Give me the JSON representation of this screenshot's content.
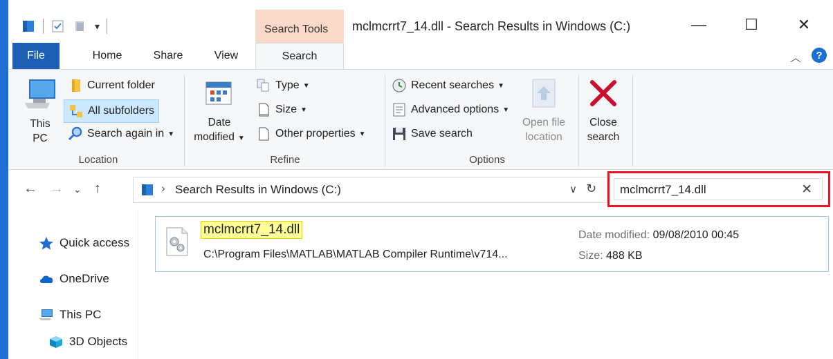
{
  "window": {
    "title": "mclmcrrt7_14.dll - Search Results in Windows (C:)",
    "context_tab_group": "Search Tools",
    "minimize": "—",
    "maximize": "☐",
    "close": "✕"
  },
  "tabs": [
    {
      "label": "File"
    },
    {
      "label": "Home"
    },
    {
      "label": "Share"
    },
    {
      "label": "View"
    },
    {
      "label": "Search"
    }
  ],
  "ribbon": {
    "location": {
      "label": "Location",
      "this_pc_line1": "This",
      "this_pc_line2": "PC",
      "current_folder": "Current folder",
      "all_subfolders": "All subfolders",
      "search_again_in": "Search again in"
    },
    "refine": {
      "label": "Refine",
      "date_line1": "Date",
      "date_line2": "modified",
      "type": "Type",
      "size": "Size",
      "other_properties": "Other properties"
    },
    "options": {
      "label": "Options",
      "recent_searches": "Recent searches",
      "advanced_options": "Advanced options",
      "save_search": "Save search",
      "open_file_location_line1": "Open file",
      "open_file_location_line2": "location"
    },
    "close_search": {
      "line1": "Close",
      "line2": "search"
    }
  },
  "address": {
    "path": "Search Results in Windows (C:)",
    "separator": "›"
  },
  "search": {
    "query": "mclmcrrt7_14.dll",
    "clear": "✕"
  },
  "navpane": {
    "items": [
      {
        "label": "Quick access"
      },
      {
        "label": "OneDrive"
      },
      {
        "label": "This PC"
      },
      {
        "label": "3D Objects"
      }
    ]
  },
  "result": {
    "name": "mclmcrrt7_14.dll",
    "path": "C:\\Program Files\\MATLAB\\MATLAB Compiler Runtime\\v714...",
    "date_label": "Date modified:",
    "date_value": "09/08/2010 00:45",
    "size_label": "Size:",
    "size_value": "488 KB"
  },
  "colors": {
    "accent": "#1c5fb4",
    "context_tab": "#fad9c8",
    "highlight_box": "#e81224",
    "match_highlight": "#ffff99"
  }
}
